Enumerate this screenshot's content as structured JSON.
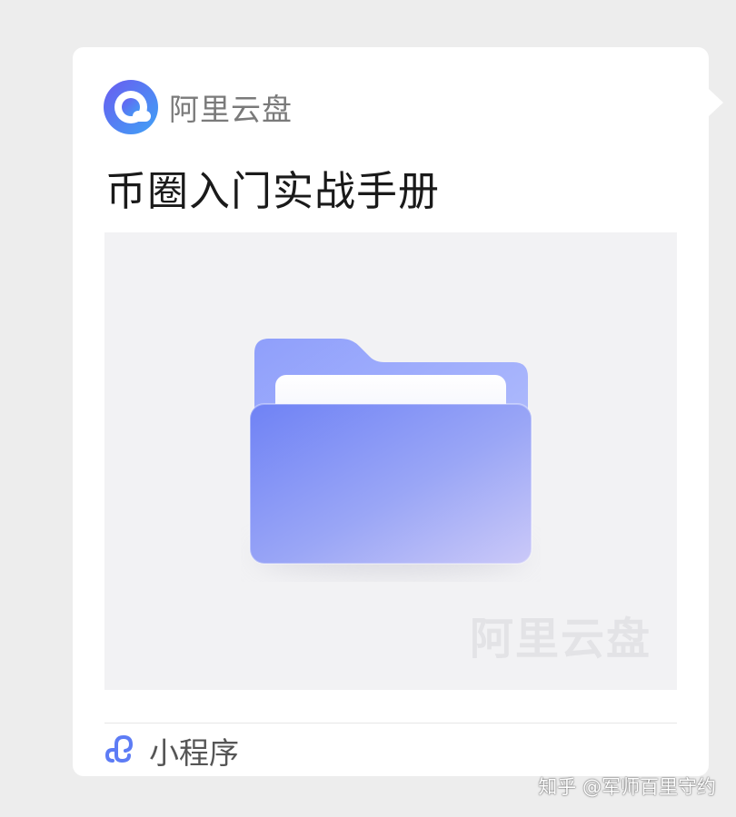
{
  "card": {
    "app_name": "阿里云盘",
    "app_logo_icon": "aliyun-drive-logo-icon",
    "title": "币圈入门实战手册",
    "preview": {
      "image": "folder-icon",
      "watermark": "阿里云盘"
    },
    "footer": {
      "icon": "mini-program-icon",
      "label": "小程序"
    }
  },
  "attribution": "知乎 @军师百里守约",
  "colors": {
    "background": "#ededed",
    "card": "#ffffff",
    "brand_blue": "#5d7cf5",
    "folder_front": "#7b8cf6",
    "folder_back": "#9fb0fb"
  }
}
